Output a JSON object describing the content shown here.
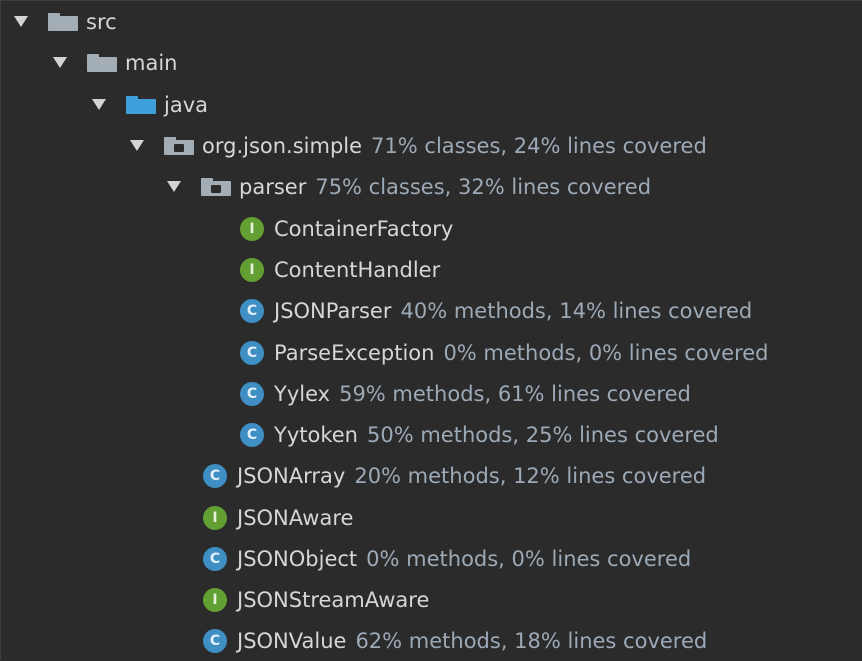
{
  "tree": {
    "src": {
      "name": "src"
    },
    "main": {
      "name": "main"
    },
    "java": {
      "name": "java"
    },
    "pkg_simple": {
      "name": "org.json.simple",
      "coverage": "71% classes, 24% lines covered"
    },
    "pkg_parser": {
      "name": "parser",
      "coverage": "75% classes, 32% lines covered"
    },
    "parser_items": [
      {
        "name": "ContainerFactory",
        "kind": "interface",
        "badge": "I",
        "coverage": ""
      },
      {
        "name": "ContentHandler",
        "kind": "interface",
        "badge": "I",
        "coverage": ""
      },
      {
        "name": "JSONParser",
        "kind": "class",
        "badge": "C",
        "coverage": "40% methods, 14% lines covered"
      },
      {
        "name": "ParseException",
        "kind": "class",
        "badge": "C",
        "coverage": "0% methods, 0% lines covered"
      },
      {
        "name": "Yylex",
        "kind": "class",
        "badge": "C",
        "coverage": "59% methods, 61% lines covered"
      },
      {
        "name": "Yytoken",
        "kind": "class",
        "badge": "C",
        "coverage": "50% methods, 25% lines covered"
      }
    ],
    "simple_items": [
      {
        "name": "JSONArray",
        "kind": "class",
        "badge": "C",
        "coverage": "20% methods, 12% lines covered"
      },
      {
        "name": "JSONAware",
        "kind": "interface",
        "badge": "I",
        "coverage": ""
      },
      {
        "name": "JSONObject",
        "kind": "class",
        "badge": "C",
        "coverage": "0% methods, 0% lines covered"
      },
      {
        "name": "JSONStreamAware",
        "kind": "interface",
        "badge": "I",
        "coverage": ""
      },
      {
        "name": "JSONValue",
        "kind": "class",
        "badge": "C",
        "coverage": "62% methods, 18% lines covered"
      }
    ]
  },
  "colors": {
    "background": "#2b2b2b",
    "interface_badge": "#63a033",
    "class_badge": "#3f8fc4",
    "source_folder": "#3d9fdb",
    "folder": "#a3adb5"
  },
  "icons": {
    "expand": "chevron-down-icon",
    "folder": "folder-icon",
    "source_folder": "source-folder-icon",
    "package": "package-icon",
    "interface": "interface-icon",
    "class": "class-icon"
  }
}
